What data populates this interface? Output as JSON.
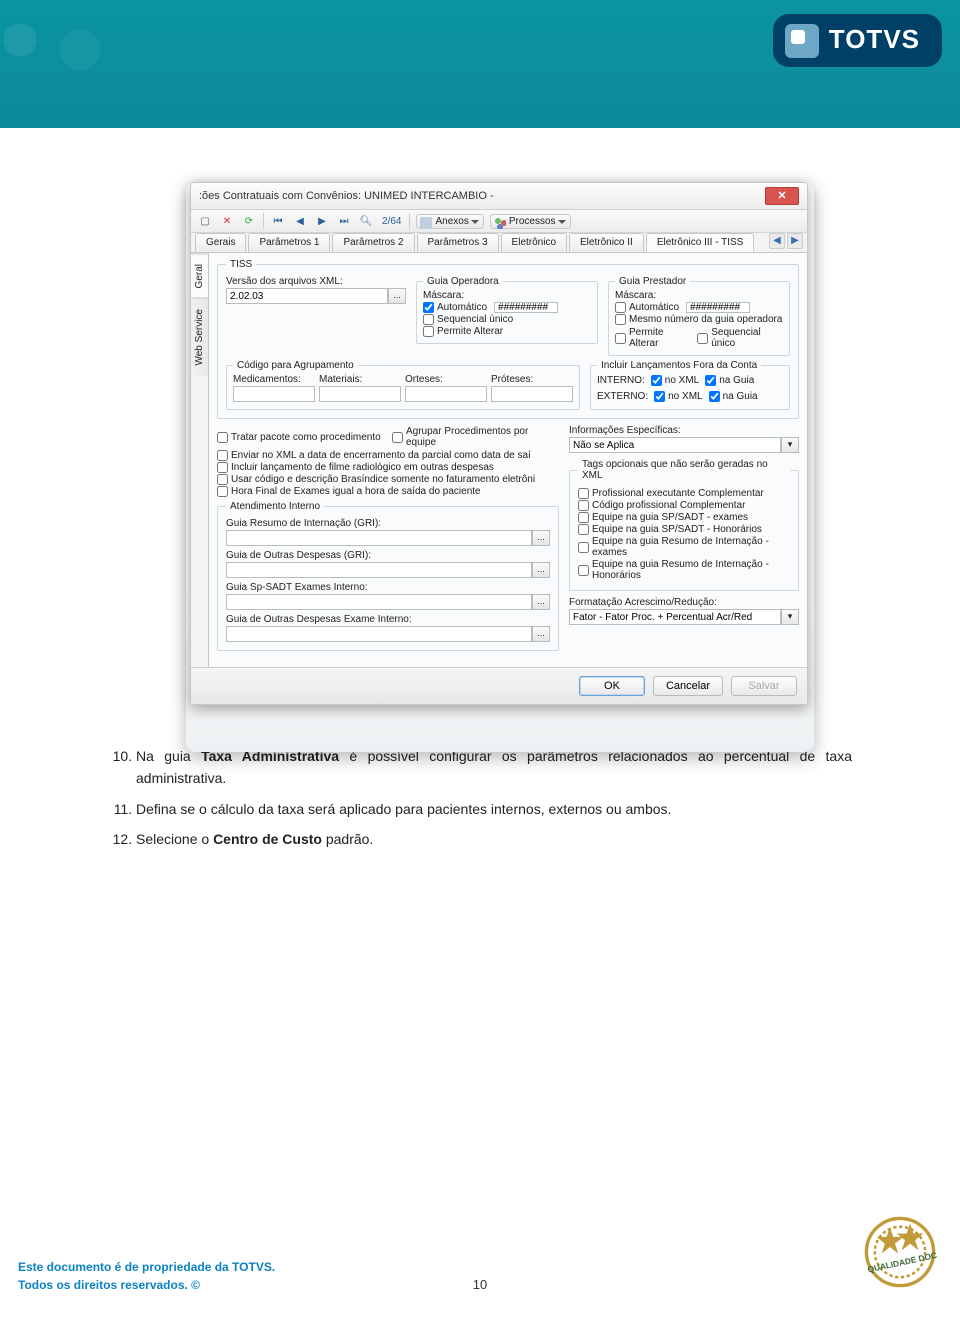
{
  "brand": "TOTVS",
  "window_title": ":ões Contratuais com Convênios: UNIMED INTERCAMBIO -",
  "pager": "2/64",
  "toolbar": {
    "anexos": "Anexos",
    "processos": "Processos"
  },
  "tabs": [
    "Gerais",
    "Parâmetros 1",
    "Parâmetros 2",
    "Parâmetros 3",
    "Eletrônico",
    "Eletrônico II",
    "Eletrônico III - TISS"
  ],
  "side_tabs": [
    "Geral",
    "Web Service"
  ],
  "tiss": {
    "legend": "TISS",
    "versao_label": "Versão dos arquivos XML:",
    "versao_value": "2.02.03",
    "operadora": {
      "legend": "Guia Operadora",
      "mascara": "Máscara:",
      "auto": "Automático",
      "auto_val": "#########",
      "seq": "Sequencial único",
      "permite": "Permite Alterar"
    },
    "prestador": {
      "legend": "Guia Prestador",
      "mascara": "Máscara:",
      "auto": "Automático",
      "auto_val": "#########",
      "mesmo": "Mesmo número da guia operadora",
      "permite": "Permite Alterar",
      "seq": "Sequencial único"
    },
    "agrup": {
      "legend": "Código para Agrupamento",
      "med": "Medicamentos:",
      "mat": "Materiais:",
      "ort": "Orteses:",
      "prot": "Próteses:"
    },
    "lanc": {
      "legend": "Incluir Lançamentos Fora da Conta",
      "interno": "INTERNO:",
      "externo": "EXTERNO:",
      "noxml": "no XML",
      "naguia": "na Guia"
    }
  },
  "checks": {
    "tratar": "Tratar pacote como procedimento",
    "agrupar": "Agrupar Procedimentos por equipe",
    "enviar": "Enviar no XML a data de encerramento da parcial como data de saí",
    "filme": "Incluir lançamento de filme radiológico em outras despesas",
    "brasidice": "Usar código e descrição Brasíndice somente no faturamento eletrôni",
    "hora": "Hora Final de Exames igual a hora de saída do paciente"
  },
  "atend": {
    "legend": "Atendimento Interno",
    "gri": "Guia Resumo de Internação (GRI):",
    "outras_gri": "Guia de Outras Despesas (GRI):",
    "spsadt": "Guia Sp-SADT Exames Interno:",
    "outras_ex": "Guia de Outras Despesas Exame Interno:"
  },
  "info": {
    "label": "Informações Específicas:",
    "value": "Não se Aplica"
  },
  "tags": {
    "legend": "Tags opcionais que não serão geradas no XML",
    "c1": "Profissional executante Complementar",
    "c2": "Código profissional Complementar",
    "c3": "Equipe na guia SP/SADT - exames",
    "c4": "Equipe na guia SP/SADT - Honorários",
    "c5": "Equipe na guia Resumo de Internação - exames",
    "c6": "Equipe na guia Resumo de Internação - Honorários"
  },
  "formatacao": {
    "label": "Formatação Acrescimo/Redução:",
    "value": "Fator - Fator Proc. + Percentual Acr/Red"
  },
  "buttons": {
    "ok": "OK",
    "cancelar": "Cancelar",
    "salvar": "Salvar"
  },
  "doc": {
    "item10": {
      "n": "10.",
      "pre": "Na guia ",
      "b": "Taxa Administrativa",
      "post": " é possível configurar os parâmetros relacionados ao percentual de taxa administrativa."
    },
    "item11": {
      "n": "11.",
      "text": "Defina se o cálculo da taxa será aplicado para pacientes internos, externos ou ambos."
    },
    "item12": {
      "n": "12.",
      "pre": "Selecione o ",
      "b": "Centro de Custo",
      "post": " padrão."
    }
  },
  "footer": {
    "l1": "Este documento é de propriedade da TOTVS.",
    "l2": "Todos os direitos reservados. ©",
    "page": "10",
    "seal": "QUALIDADE DOC"
  }
}
